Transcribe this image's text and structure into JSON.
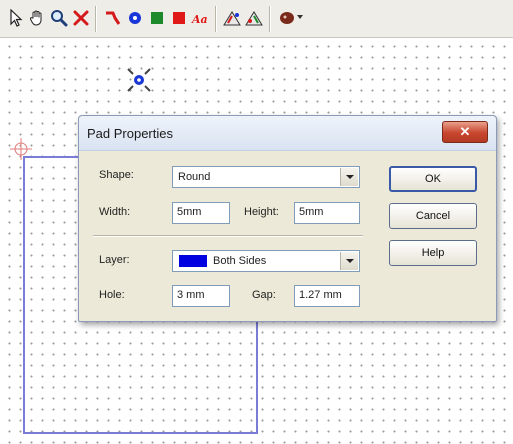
{
  "toolbar": {
    "icons": [
      "select-arrow-icon",
      "hand-pan-icon",
      "zoom-icon",
      "delete-x-icon",
      "track-icon",
      "pad-icon",
      "square-pad-icon",
      "rect-fill-icon",
      "text-icon",
      "autoroute-icon",
      "autoroute2-icon",
      "component-icon"
    ]
  },
  "dialog": {
    "title": "Pad Properties",
    "close_symbol": "✕",
    "shape_label": "Shape:",
    "shape_value": "Round",
    "width_label": "Width:",
    "width_value": "5mm",
    "height_label": "Height:",
    "height_value": "5mm",
    "layer_label": "Layer:",
    "layer_value": "Both Sides",
    "layer_color": "#0000e0",
    "hole_label": "Hole:",
    "hole_value": "3 mm",
    "gap_label": "Gap:",
    "gap_value": "1.27 mm",
    "ok_label": "OK",
    "cancel_label": "Cancel",
    "help_label": "Help"
  },
  "colors": {
    "board_outline": "#7a7cd6",
    "grid_dot": "#9a9a9a",
    "close_button": "#c8452e"
  }
}
